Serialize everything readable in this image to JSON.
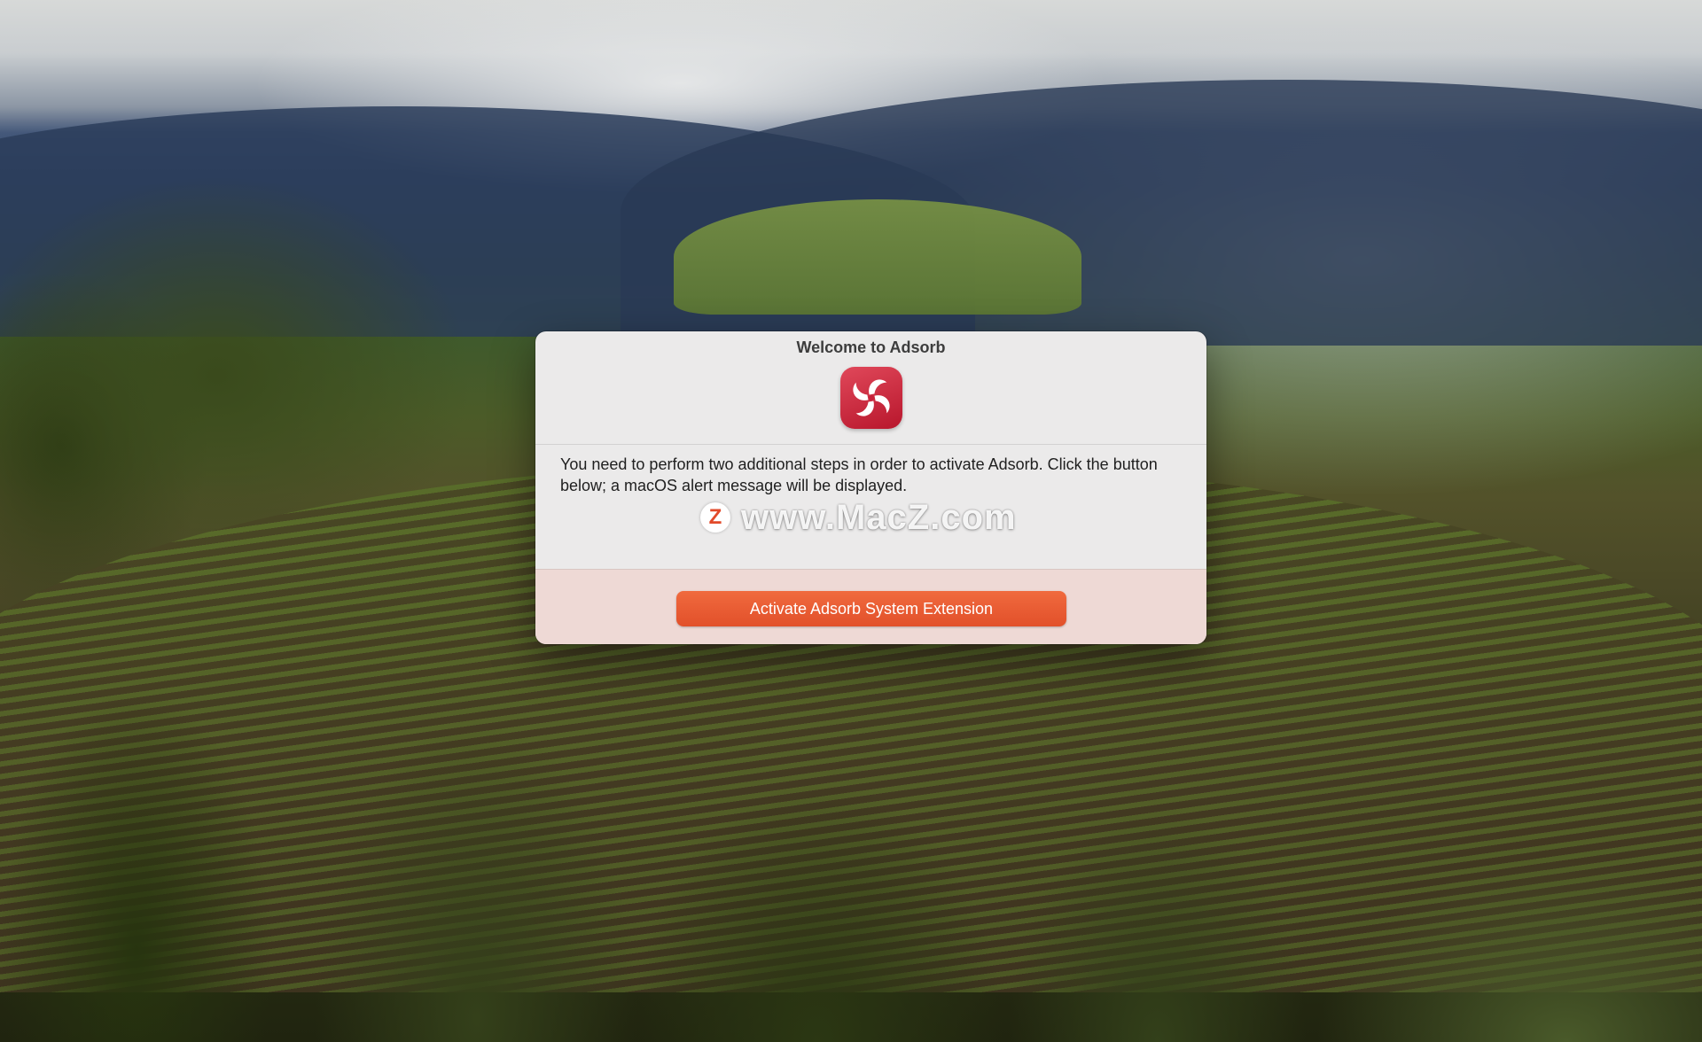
{
  "dialog": {
    "title": "Welcome to Adsorb",
    "app_icon": "adsorb-app-icon",
    "message": "You need to perform two additional steps in order to activate Adsorb. Click the button below; a macOS alert message will be displayed.",
    "button_label": "Activate Adsorb System Extension"
  },
  "watermark": {
    "logo_letter": "Z",
    "text": "www.MacZ.com"
  },
  "colors": {
    "accent_button": "#e85a30",
    "footer_background": "#eed9d5",
    "app_icon_red": "#c8213a"
  }
}
